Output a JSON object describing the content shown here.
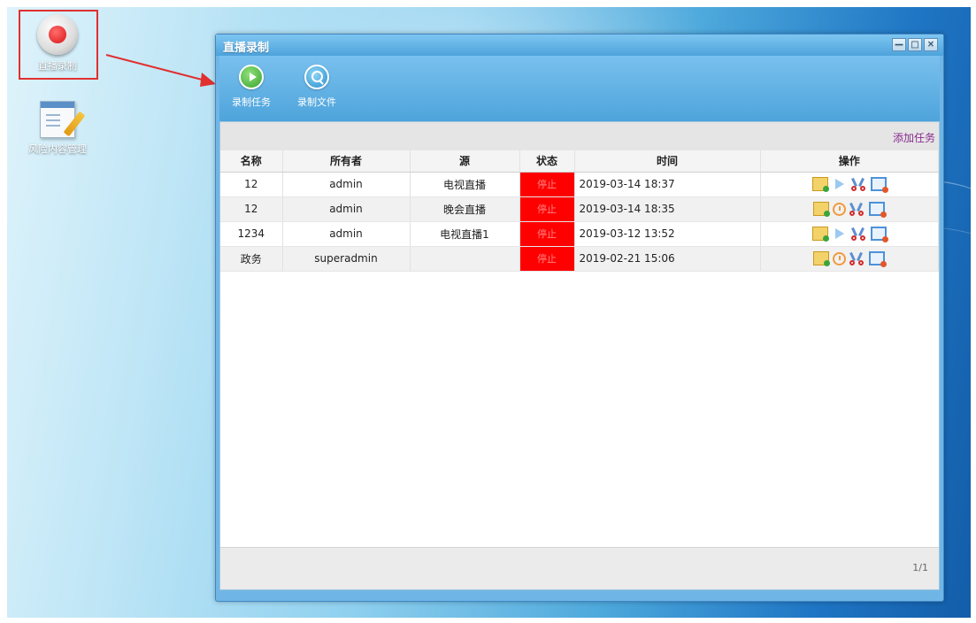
{
  "desktop": {
    "icons": [
      {
        "label": "直播录制"
      },
      {
        "label": "风险内容管理"
      }
    ]
  },
  "window": {
    "title": "直播录制",
    "controls": {
      "minimize": "—",
      "maximize": "□",
      "close": "✕"
    },
    "toolbar": {
      "record_task": "录制任务",
      "record_file": "录制文件"
    },
    "add_task": "添加任务",
    "table": {
      "headers": [
        "名称",
        "所有者",
        "源",
        "状态",
        "时间",
        "操作"
      ],
      "rows": [
        {
          "name": "12",
          "owner": "admin",
          "source": "电视直播",
          "status": "停止",
          "time": "2019-03-14 18:37",
          "ops": [
            "edit-icon",
            "play-icon",
            "cut-icon",
            "file-icon"
          ]
        },
        {
          "name": "12",
          "owner": "admin",
          "source": "晚会直播",
          "status": "停止",
          "time": "2019-03-14 18:35",
          "ops": [
            "edit-icon",
            "clock-icon",
            "cut-icon",
            "file-icon"
          ]
        },
        {
          "name": "1234",
          "owner": "admin",
          "source": "电视直播1",
          "status": "停止",
          "time": "2019-03-12 13:52",
          "ops": [
            "edit-icon",
            "play-icon",
            "cut-icon",
            "file-icon"
          ]
        },
        {
          "name": "政务",
          "owner": "superadmin",
          "source": "",
          "status": "停止",
          "time": "2019-02-21 15:06",
          "ops": [
            "edit-icon",
            "clock-icon",
            "cut-icon",
            "file-icon"
          ]
        }
      ]
    },
    "pager": "1/1"
  },
  "colors": {
    "status_stopped": "#ff0000",
    "add_task_link": "#8a2a90",
    "annotation": "#e03030"
  }
}
